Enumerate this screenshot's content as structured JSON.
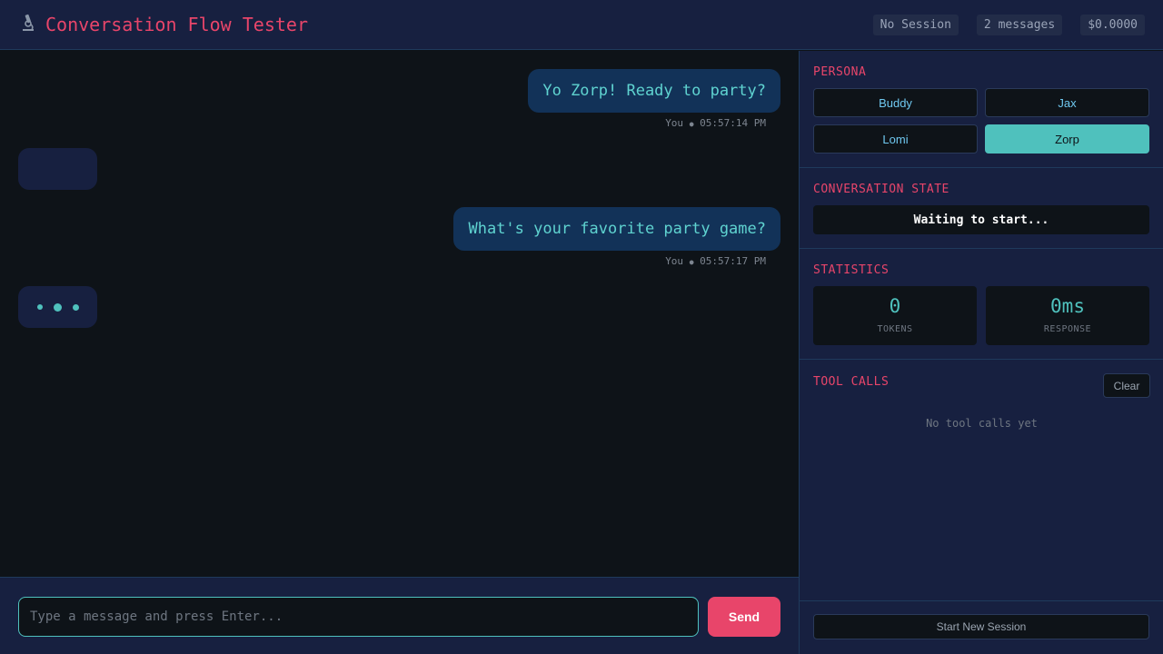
{
  "header": {
    "logo_icon": "microscope-icon",
    "title": "Conversation Flow Tester",
    "session_status": "No Session",
    "message_count": "2 messages",
    "cost": "$0.0000"
  },
  "chat": {
    "messages": [
      {
        "role": "user",
        "text": "Yo Zorp! Ready to party?",
        "sender": "You",
        "time": "05:57:14 PM"
      },
      {
        "role": "bot",
        "text": ""
      },
      {
        "role": "user",
        "text": "What's your favorite party game?",
        "sender": "You",
        "time": "05:57:17 PM"
      },
      {
        "role": "bot",
        "typing": true
      }
    ],
    "meta_separator": "●"
  },
  "input": {
    "placeholder": "Type a message and press Enter...",
    "value": "",
    "send_label": "Send"
  },
  "sidebar": {
    "persona": {
      "title": "PERSONA",
      "options": [
        "Buddy",
        "Jax",
        "Lomi",
        "Zorp"
      ],
      "selected": "Zorp"
    },
    "state": {
      "title": "CONVERSATION STATE",
      "value": "Waiting to start..."
    },
    "statistics": {
      "title": "STATISTICS",
      "tokens_value": "0",
      "tokens_label": "TOKENS",
      "response_value": "0ms",
      "response_label": "RESPONSE"
    },
    "tool_calls": {
      "title": "TOOL CALLS",
      "clear_label": "Clear",
      "empty_text": "No tool calls yet"
    },
    "new_session_label": "Start New Session"
  },
  "colors": {
    "accent_pink": "#e8456a",
    "accent_teal": "#4fc1bd",
    "panel": "#172040",
    "background": "#0e1318"
  }
}
